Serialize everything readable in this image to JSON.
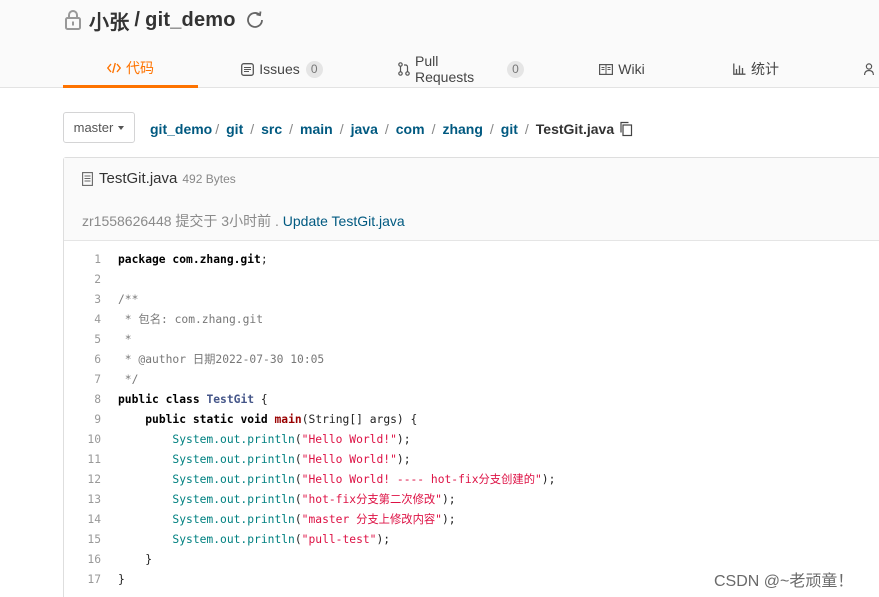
{
  "repo": {
    "owner": "小张",
    "separator": "/",
    "name": "git_demo"
  },
  "tabs": [
    {
      "label": "代码",
      "icon": "code-icon",
      "active": true
    },
    {
      "label": "Issues",
      "count": "0",
      "icon": "issues-icon"
    },
    {
      "label": "Pull Requests",
      "count": "0",
      "icon": "pull-request-icon"
    },
    {
      "label": "Wiki",
      "icon": "wiki-icon"
    },
    {
      "label": "统计",
      "icon": "stats-icon"
    }
  ],
  "branch": {
    "label": "master"
  },
  "breadcrumb": {
    "segments": [
      "git_demo",
      "git",
      "src",
      "main",
      "java",
      "com",
      "zhang",
      "git"
    ],
    "separator": "/",
    "current": "TestGit.java"
  },
  "file": {
    "name": "TestGit.java",
    "size": "492 Bytes",
    "commit_author": "zr1558626448 提交于 3小时前 .",
    "commit_message": "Update TestGit.java"
  },
  "code": {
    "lines": [
      "package com.zhang.git;",
      "",
      "/**",
      " * 包名: com.zhang.git",
      " *",
      " * @author 日期2022-07-30 10:05",
      " */",
      "public class TestGit {",
      "    public static void main(String[] args) {",
      "        System.out.println(\"Hello World!\");",
      "        System.out.println(\"Hello World!\");",
      "        System.out.println(\"Hello World! ---- hot-fix分支创建的\");",
      "        System.out.println(\"hot-fix分支第二次修改\");",
      "        System.out.println(\"master 分支上修改内容\");",
      "        System.out.println(\"pull-test\");",
      "    }",
      "}"
    ]
  },
  "watermark": "CSDN @~老顽童！",
  "colors": {
    "accent": "#fe7300",
    "link": "#005980",
    "keyword": "#000000",
    "string": "#dd1144",
    "member": "#008080",
    "type": "#445588"
  }
}
